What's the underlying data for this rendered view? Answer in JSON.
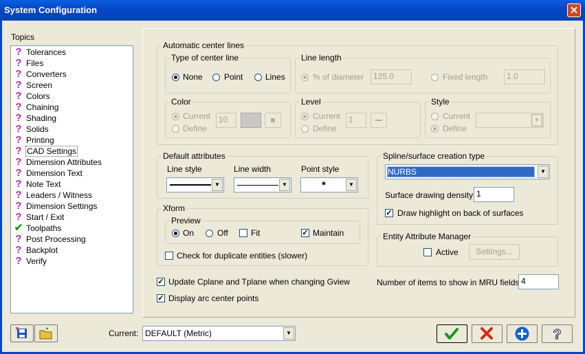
{
  "window": {
    "title": "System Configuration"
  },
  "topics": {
    "label": "Topics",
    "items": [
      {
        "label": "Tolerances",
        "status": "question"
      },
      {
        "label": "Files",
        "status": "question"
      },
      {
        "label": "Converters",
        "status": "question"
      },
      {
        "label": "Screen",
        "status": "question"
      },
      {
        "label": "Colors",
        "status": "question"
      },
      {
        "label": "Chaining",
        "status": "question"
      },
      {
        "label": "Shading",
        "status": "question"
      },
      {
        "label": "Solids",
        "status": "question"
      },
      {
        "label": "Printing",
        "status": "question"
      },
      {
        "label": "CAD Settings",
        "status": "question",
        "selected": true
      },
      {
        "label": "Dimension Attributes",
        "status": "question"
      },
      {
        "label": "Dimension Text",
        "status": "question"
      },
      {
        "label": "Note Text",
        "status": "question"
      },
      {
        "label": "Leaders / Witness",
        "status": "question"
      },
      {
        "label": "Dimension Settings",
        "status": "question"
      },
      {
        "label": "Start / Exit",
        "status": "question"
      },
      {
        "label": "Toolpaths",
        "status": "check"
      },
      {
        "label": "Post Processing",
        "status": "question"
      },
      {
        "label": "Backplot",
        "status": "question"
      },
      {
        "label": "Verify",
        "status": "question"
      }
    ]
  },
  "auto_center": {
    "title": "Automatic center lines",
    "type": {
      "title": "Type of center line",
      "none": "None",
      "point": "Point",
      "lines": "Lines"
    },
    "length": {
      "title": "Line length",
      "pct": "% of diameter",
      "pct_value": "125.0",
      "fixed": "Fixed length",
      "fixed_value": "1.0"
    },
    "color": {
      "title": "Color",
      "current": "Current",
      "define": "Define",
      "value": "10"
    },
    "level": {
      "title": "Level",
      "current": "Current",
      "define": "Define",
      "value": "1"
    },
    "style": {
      "title": "Style",
      "current": "Current",
      "define": "Define"
    }
  },
  "default_attrs": {
    "title": "Default attributes",
    "line_style": "Line style",
    "line_width": "Line width",
    "point_style": "Point style",
    "point_glyph": "*"
  },
  "spline": {
    "title": "Spline/surface creation type",
    "value": "NURBS",
    "density_label": "Surface drawing density",
    "density_value": "1",
    "highlight_label": "Draw highlight on back of surfaces"
  },
  "xform": {
    "title": "Xform",
    "preview_title": "Preview",
    "on": "On",
    "off": "Off",
    "fit": "Fit",
    "maintain": "Maintain",
    "dup_label": "Check for duplicate entities (slower)"
  },
  "entity_mgr": {
    "title": "Entity Attribute Manager",
    "active": "Active",
    "settings": "Settings..."
  },
  "update_cplane": "Update Cplane and Tplane when changing Gview",
  "arc_center": "Display arc center points",
  "mru": {
    "label": "Number of items to show in MRU fields:",
    "value": "4"
  },
  "bottom": {
    "current_label": "Current:",
    "current_value": "DEFAULT (Metric)"
  },
  "colors": {
    "ok": "#1a9a1a",
    "cancel": "#d62a10",
    "add": "#1060d0",
    "selection": "#316ac5"
  }
}
